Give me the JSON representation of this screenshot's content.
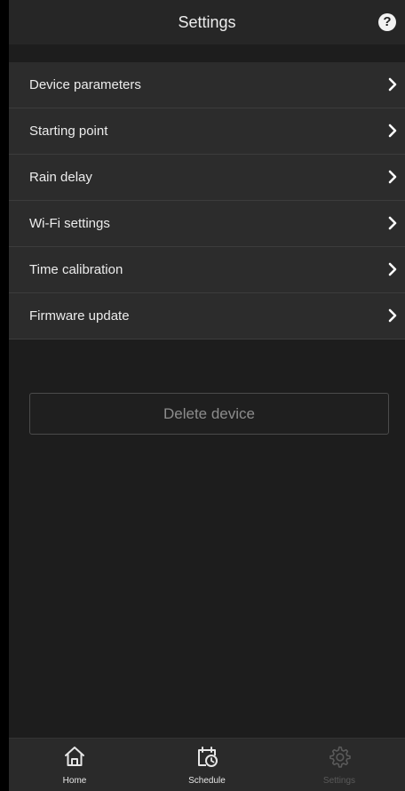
{
  "header": {
    "title": "Settings",
    "help_glyph": "?",
    "help_icon": "help-icon"
  },
  "menu": {
    "items": [
      {
        "label": "Device parameters"
      },
      {
        "label": "Starting point"
      },
      {
        "label": "Rain delay"
      },
      {
        "label": "Wi-Fi settings"
      },
      {
        "label": "Time calibration"
      },
      {
        "label": "Firmware update"
      }
    ]
  },
  "delete_button": {
    "label": "Delete device"
  },
  "tabbar": {
    "tabs": [
      {
        "label": "Home",
        "icon": "home-icon",
        "active": true
      },
      {
        "label": "Schedule",
        "icon": "calendar-clock-icon",
        "active": true
      },
      {
        "label": "Settings",
        "icon": "gear-icon",
        "active": false
      }
    ]
  },
  "colors": {
    "background": "#1d1d1d",
    "menu_item": "#2c2c2c",
    "text": "#ececec",
    "disabled_text": "#5a5a5a"
  }
}
